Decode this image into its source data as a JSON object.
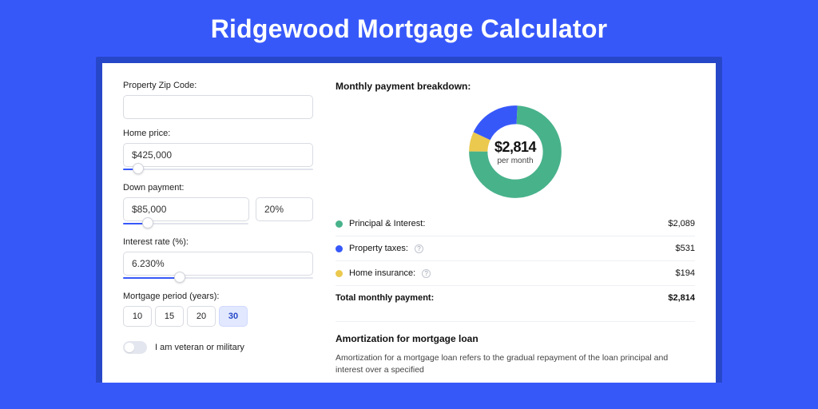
{
  "colors": {
    "principal": "#48b28b",
    "taxes": "#3758f9",
    "insurance": "#ebc94e"
  },
  "title": "Ridgewood Mortgage Calculator",
  "form": {
    "zip_label": "Property Zip Code:",
    "zip_value": "",
    "home_price_label": "Home price:",
    "home_price_value": "$425,000",
    "home_price_slider_pct": 8,
    "down_payment_label": "Down payment:",
    "down_payment_value": "$85,000",
    "down_payment_pct_value": "20%",
    "down_payment_slider_pct": 20,
    "interest_label": "Interest rate (%):",
    "interest_value": "6.230%",
    "interest_slider_pct": 30,
    "period_label": "Mortgage period (years):",
    "periods": [
      {
        "label": "10",
        "active": false
      },
      {
        "label": "15",
        "active": false
      },
      {
        "label": "20",
        "active": false
      },
      {
        "label": "30",
        "active": true
      }
    ],
    "veteran_label": "I am veteran or military",
    "veteran_on": false
  },
  "breakdown": {
    "title": "Monthly payment breakdown:",
    "center_amount": "$2,814",
    "center_sub": "per month",
    "items": [
      {
        "key": "principal",
        "label": "Principal & Interest:",
        "value": "$2,089",
        "num": 2089,
        "help": false
      },
      {
        "key": "taxes",
        "label": "Property taxes:",
        "value": "$531",
        "num": 531,
        "help": true
      },
      {
        "key": "insurance",
        "label": "Home insurance:",
        "value": "$194",
        "num": 194,
        "help": true
      }
    ],
    "total_label": "Total monthly payment:",
    "total_value": "$2,814"
  },
  "amortization": {
    "title": "Amortization for mortgage loan",
    "text": "Amortization for a mortgage loan refers to the gradual repayment of the loan principal and interest over a specified"
  },
  "chart_data": {
    "type": "pie",
    "title": "Monthly payment breakdown",
    "series": [
      {
        "name": "Principal & Interest",
        "value": 2089
      },
      {
        "name": "Property taxes",
        "value": 531
      },
      {
        "name": "Home insurance",
        "value": 194
      }
    ],
    "total": 2814,
    "center_label": "$2,814 per month"
  }
}
